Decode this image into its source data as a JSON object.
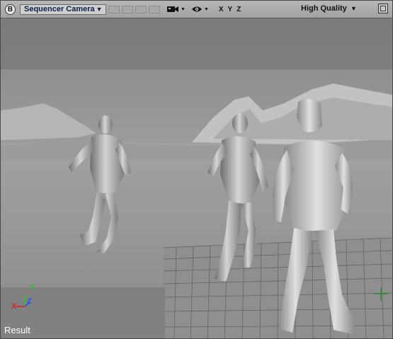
{
  "toolbar": {
    "logo_letter": "B",
    "camera_label": "Sequencer Camera",
    "axes_label": "XYZ",
    "quality_label": "High Quality",
    "icons": [
      "camera-icon",
      "eye-icon",
      "dropdown-arrow-icon",
      "maximize-icon"
    ]
  },
  "viewport": {
    "result_label": "Result",
    "gizmo": {
      "x": "X",
      "y": "Y",
      "z": "Z"
    },
    "colors": {
      "x_axis": "#d92020",
      "y_axis": "#20c820",
      "z_axis": "#2a4dff"
    }
  }
}
